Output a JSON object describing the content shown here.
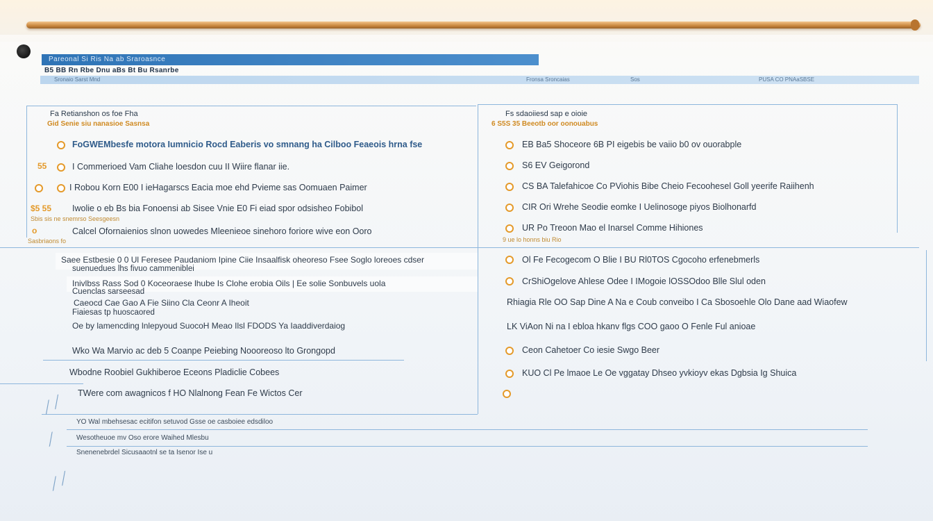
{
  "header": {
    "bar_text": "Pareonal Si Ris   Na   ab Sraroasnce",
    "subline": "B5 BB Rn Rbe Dnu aBs Bt Bu Rsanrbe",
    "band": [
      "Sronaio Sarst   Mnd",
      "Fronsa Sroncaias",
      "Sos",
      "PUSA CO PNAaSBSE"
    ]
  },
  "left_panel": {
    "title": "Fa Retianshon os foe Fha",
    "subtitle": "Gid Senie siu nanasioe Sasnsa",
    "items": [
      {
        "text": "FoGWEMbesfe motora Iumnicio Rocd Eaberis vo smnang ha Cilboo Feaeois hrna fse",
        "bold": true
      },
      {
        "text": "I Commerioed Vam Cliahe loesdon cuu II Wiire flanar iie."
      },
      {
        "text": "I Robou Korn E00 I ieHagarscs Eacia moe ehd Pvieme sas Oomuaen Paimer",
        "bold": false
      },
      {
        "text": "Iwolie o eb Bs bia Fonoensi ab Sisee Vnie E0 Fi eiad spor odsisheo Fobibol"
      },
      {
        "text": "Calcel Ofornaienios slnon uowedes Mleenieoe sinehoro foriore wive eon Ooro"
      }
    ],
    "marks": [
      "55",
      "$5 55",
      "o"
    ],
    "notes": [
      "Sbis sis ne snemrso Seesgeesn",
      "Sasbriaons fo"
    ]
  },
  "left_lower": {
    "items": [
      "Saee Estbesie 0 0 Ul Feresee Paudaniom Ipine Ciie Insaalfisk oheoreso Fsee Soglo loreoes cdser",
      "suenuedues lhs fivuo cammeniblei",
      "Inivlbss Rass Sod 0 Koceoraese lhube Is Clohe erobia Oils | Ee solie Sonbuvels uola",
      "Cuenclas sarseesad",
      "Caeocd Cae Gao A Fie Siino Cla Ceonr A Iheoit",
      "Fiaiesas tp huoscaored",
      "Oe by lamencding lnlepyoud SuocoH Meao Ilsl FDODS Ya Iaaddiverdaiog",
      "Wko Wa Marvio ac deb 5 Coanpe Peiebing Noooreoso lto Grongopd",
      "Wbodne Roobiel Gukhiberoe Eceons Pladiclie Cobees",
      "TWere com awagnicos f HO Nlalnong Fean Fe Wictos Cer"
    ]
  },
  "right_panel": {
    "title": "Fs sdaoiiesd sap e oioie",
    "subtitle": "6 S5S 35 Beeotb oor oonouabus",
    "items": [
      "EB Ba5 Shoceore 6B PI eigebis be vaiio b0 ov ouorabple",
      "S6 EV Geigorond",
      "CS BA Talefahicoe Co PViohis Bibe Cheio Fecoohesel Goll yeerife Raiihenh",
      "CIR Ori Wrehe Seodie eomke I Uelinosoge piyos Biolhonarfd",
      "UR Po Treoon Mao el Inarsel Comme Hihiones",
      "Ol Fe Fecogecom O Blie I BU Rl0TOS Cgocoho erfenebmerls",
      "CrShiOgelove Ahlese Odee I IMogoie lOSSOdoo Blle Slul oden",
      "Rhiagia Rle OO Sap Dine A Na e Coub conveibo I Ca Sbosoehle Olo Dane aad Wiaofew",
      "LK ViAon Ni na I ebloa hkanv flgs COO gaoo O Fenle Ful anioae",
      "Ceon Cahetoer Co iesie Swgo Beer",
      "KUO Cl Pe lmaoe Le Oe vggatay Dhseo yvkioyv ekas Dgbsia Ig Shuica"
    ],
    "note": "9 ue lo honns biu Rio"
  },
  "footer": {
    "lines": [
      "YO Wal mbehsesac ecitifon setuvod Gsse oe casboiee edsdiloo",
      "Wesotheuoe mv Oso erore Waihed Mlesbu",
      "Snenenebrdel Sicusaaotnl se ta Isenor Ise u"
    ]
  },
  "colors": {
    "accent_blue": "#2f74b6",
    "accent_orange": "#e49a2a",
    "rule": "#8db6dc"
  }
}
